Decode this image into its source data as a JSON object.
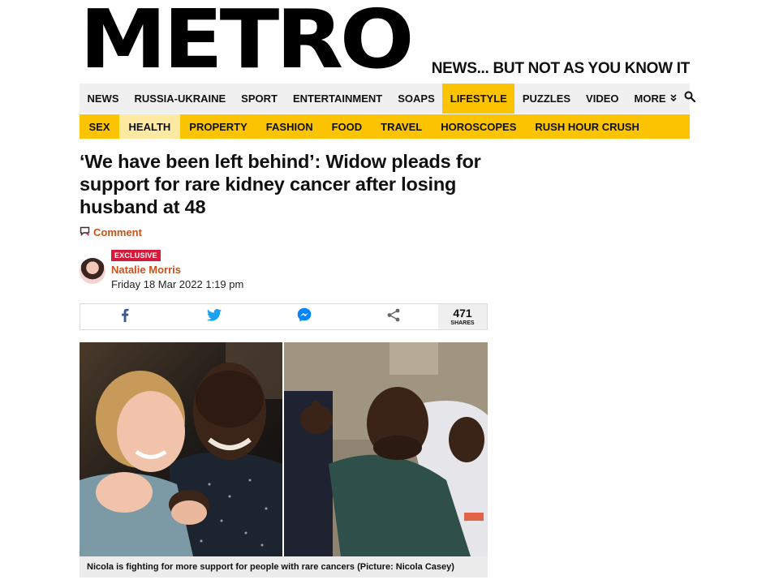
{
  "masthead": {
    "logo": "METRO",
    "tagline": "NEWS... BUT NOT AS YOU KNOW IT"
  },
  "nav_primary": {
    "items": [
      {
        "label": "NEWS",
        "active": false
      },
      {
        "label": "RUSSIA-UKRAINE",
        "active": false
      },
      {
        "label": "SPORT",
        "active": false
      },
      {
        "label": "ENTERTAINMENT",
        "active": false
      },
      {
        "label": "SOAPS",
        "active": false
      },
      {
        "label": "LIFESTYLE",
        "active": true
      },
      {
        "label": "PUZZLES",
        "active": false
      },
      {
        "label": "VIDEO",
        "active": false
      }
    ],
    "more_label": "MORE",
    "more_icon": "double-chevron-down-icon",
    "search_icon": "search-icon",
    "active_color": "#fcc300"
  },
  "nav_secondary": {
    "items": [
      {
        "label": "SEX",
        "active": false
      },
      {
        "label": "HEALTH",
        "active": true
      },
      {
        "label": "PROPERTY",
        "active": false
      },
      {
        "label": "FASHION",
        "active": false
      },
      {
        "label": "FOOD",
        "active": false
      },
      {
        "label": "TRAVEL",
        "active": false
      },
      {
        "label": "HOROSCOPES",
        "active": false
      },
      {
        "label": "RUSH HOUR CRUSH",
        "active": false
      }
    ],
    "background_color": "#fcc300"
  },
  "article": {
    "headline": "‘We have been left behind’: Widow pleads for support for rare kidney cancer after losing husband at 48",
    "comment_label": "Comment",
    "badge": "EXCLUSIVE",
    "author": "Natalie Morris",
    "published": "Friday 18 Mar 2022 1:19 pm",
    "accent_color": "#c8521d"
  },
  "share": {
    "buttons": [
      {
        "name": "facebook-icon",
        "color": "#3b5998"
      },
      {
        "name": "twitter-icon",
        "color": "#1da1f2"
      },
      {
        "name": "messenger-icon",
        "color": "#0084ff"
      },
      {
        "name": "share-icon",
        "color": "#666666"
      }
    ],
    "count": "471",
    "count_label": "SHARES"
  },
  "photo": {
    "caption": "Nicola is fighting for more support for people with rare cancers (Picture: Nicola Casey)"
  }
}
